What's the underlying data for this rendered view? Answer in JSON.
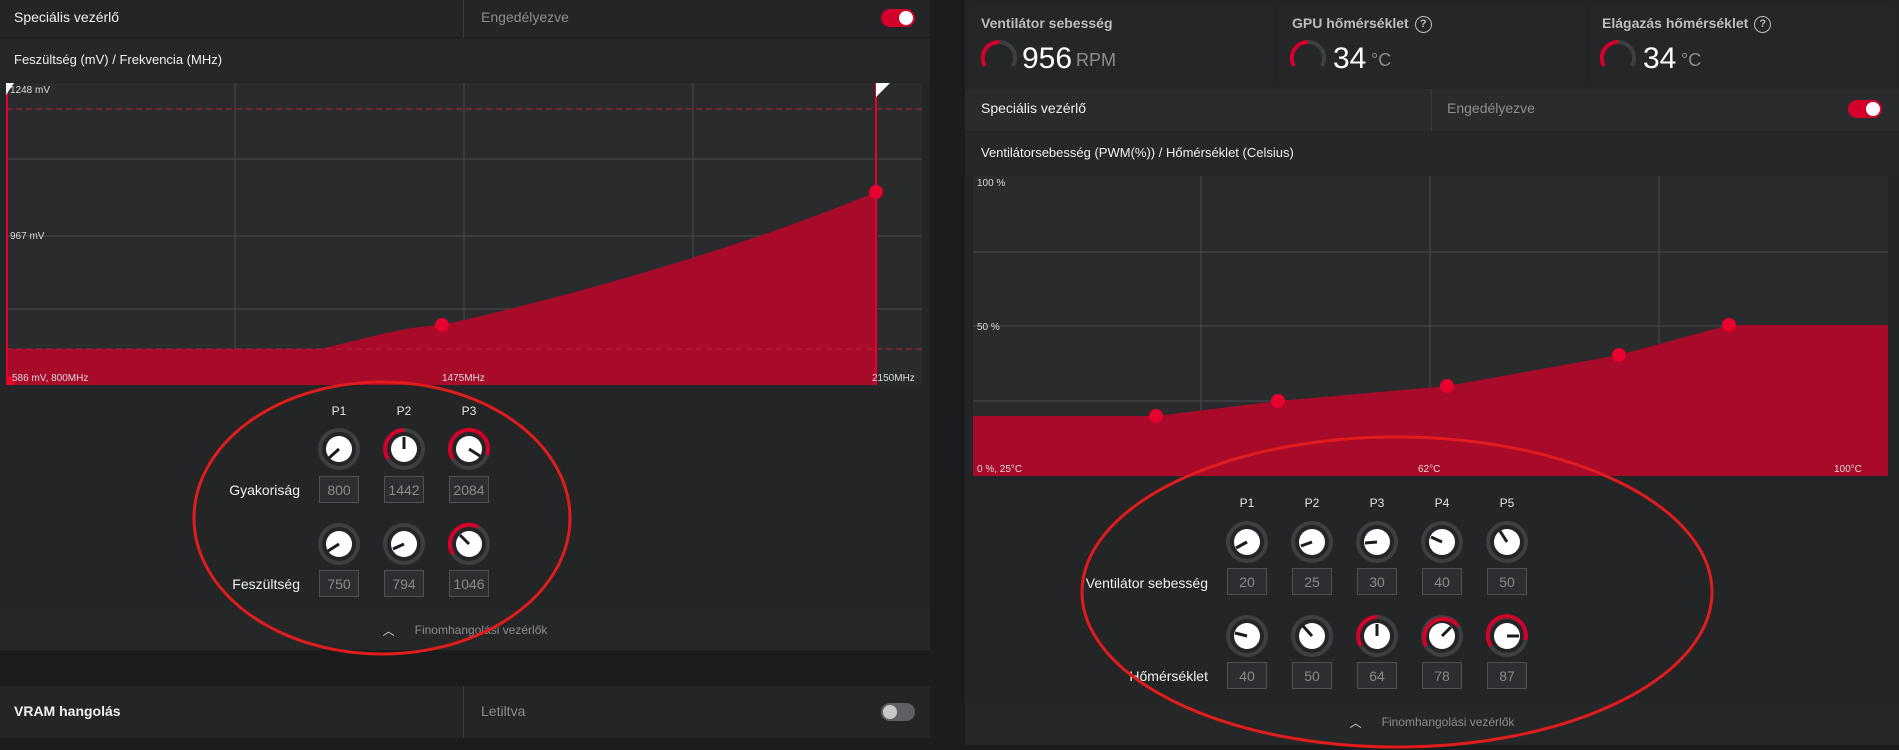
{
  "left": {
    "special_control": {
      "label": "Speciális vezérlő",
      "state": "Engedélyezve",
      "on": true
    },
    "chart_title": "Feszültség (mV) / Frekvencia (MHz)",
    "chart_labels": {
      "y_top": "1248 mV",
      "y_mid": "967 mV",
      "x_start": "586 mV, 800MHz",
      "x_mid": "1475MHz",
      "x_end": "2150MHz"
    },
    "p_labels": [
      "P1",
      "P2",
      "P3"
    ],
    "row1_label": "Gyakoriság",
    "row1_values": [
      "800",
      "1442",
      "2084"
    ],
    "row2_label": "Feszültség",
    "row2_values": [
      "750",
      "794",
      "1046"
    ],
    "footer": "Finomhangolási vezérlők",
    "vram": {
      "label": "VRAM hangolás",
      "state": "Letiltva",
      "on": false
    }
  },
  "right": {
    "metrics": [
      {
        "title": "Ventilátor sebesség",
        "value": "956",
        "unit": "RPM",
        "help": false
      },
      {
        "title": "GPU hőmérséklet",
        "value": "34",
        "unit": "°C",
        "help": true
      },
      {
        "title": "Elágazás hőmérséklet",
        "value": "34",
        "unit": "°C",
        "help": true
      }
    ],
    "help_glyph": "?",
    "special_control": {
      "label": "Speciális vezérlő",
      "state": "Engedélyezve",
      "on": true
    },
    "chart_title": "Ventilátorsebesség (PWM(%)) / Hőmérséklet (Celsius)",
    "chart_labels": {
      "y_top": "100 %",
      "y_mid": "50 %",
      "x_start": "0 %, 25°C",
      "x_mid": "62°C",
      "x_end": "100°C"
    },
    "p_labels": [
      "P1",
      "P2",
      "P3",
      "P4",
      "P5"
    ],
    "row1_label": "Ventilátor sebesség",
    "row1_values": [
      "20",
      "25",
      "30",
      "40",
      "50"
    ],
    "row2_label": "Hőmérséklet",
    "row2_values": [
      "40",
      "50",
      "64",
      "78",
      "87"
    ],
    "footer": "Finomhangolási vezérlők"
  },
  "icons": {
    "chevron": "chevron-up-icon",
    "help": "help-circle-icon",
    "gauge": "gauge-icon"
  },
  "colors": {
    "accent": "#d2002a",
    "fill": "#a80a2a",
    "annotation": "#e01c1c"
  }
}
